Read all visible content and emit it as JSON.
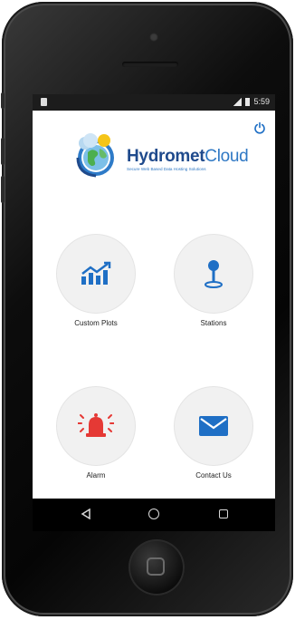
{
  "status_bar": {
    "time": "5:59"
  },
  "header": {
    "brand_part1": "Hydromet",
    "brand_part2": "Cloud",
    "tagline": "Secure Web Based Data Hosting Solutions"
  },
  "menu": [
    {
      "label": "Custom Plots",
      "icon": "chart-icon"
    },
    {
      "label": "Stations",
      "icon": "station-pin-icon"
    },
    {
      "label": "Alarm",
      "icon": "alarm-icon"
    },
    {
      "label": "Contact Us",
      "icon": "envelope-icon"
    }
  ],
  "colors": {
    "accent": "#1f6fc5",
    "brand_dark": "#1f4a8c",
    "alarm_red": "#e53935",
    "tile_bg": "#f1f1f1"
  }
}
